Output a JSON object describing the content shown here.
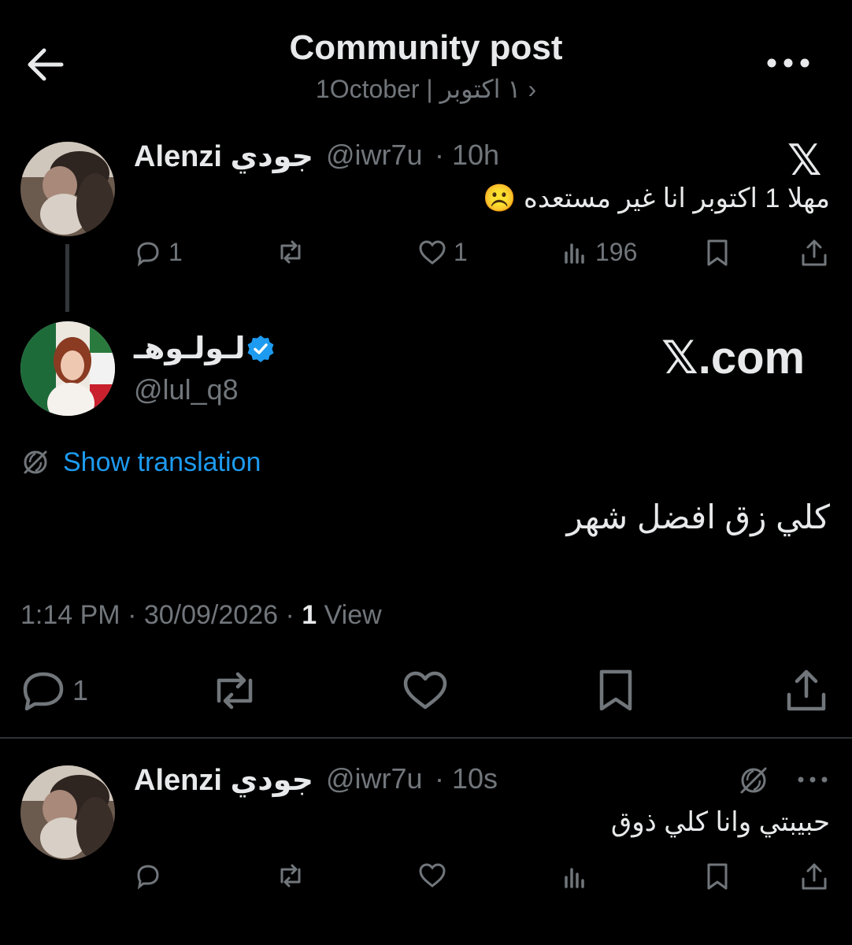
{
  "header": {
    "title": "Community post",
    "subtitle": "1October | ١ اكتوبر ›"
  },
  "reply_tweet": {
    "display_name": "Alenzi جودي",
    "handle": "@iwr7u",
    "time": "· 10h",
    "text": "مهلا 1 اكتوبر انا غير مستعده ☹️",
    "replies": "1",
    "likes": "1",
    "views": "196"
  },
  "main_tweet": {
    "display_name": "لـولـوهـ",
    "handle": "@lul_q8",
    "watermark": "𝕏.com",
    "show_translation": "Show translation",
    "text": "كلي زق افضل شهر",
    "timestamp_time": "1:14 PM",
    "timestamp_date": "· 30/09/2026 ·",
    "view_count": "1",
    "view_label": "View",
    "replies": "1"
  },
  "bottom_reply": {
    "display_name": "Alenzi جودي",
    "handle": "@iwr7u",
    "time": "· 10s",
    "text": "حبيبتي وانا كلي ذوق"
  },
  "colors": {
    "background": "#000000",
    "text": "#e7e9ea",
    "muted": "#71767b",
    "link": "#1d9bf0",
    "verified": "#1d9bf0"
  }
}
